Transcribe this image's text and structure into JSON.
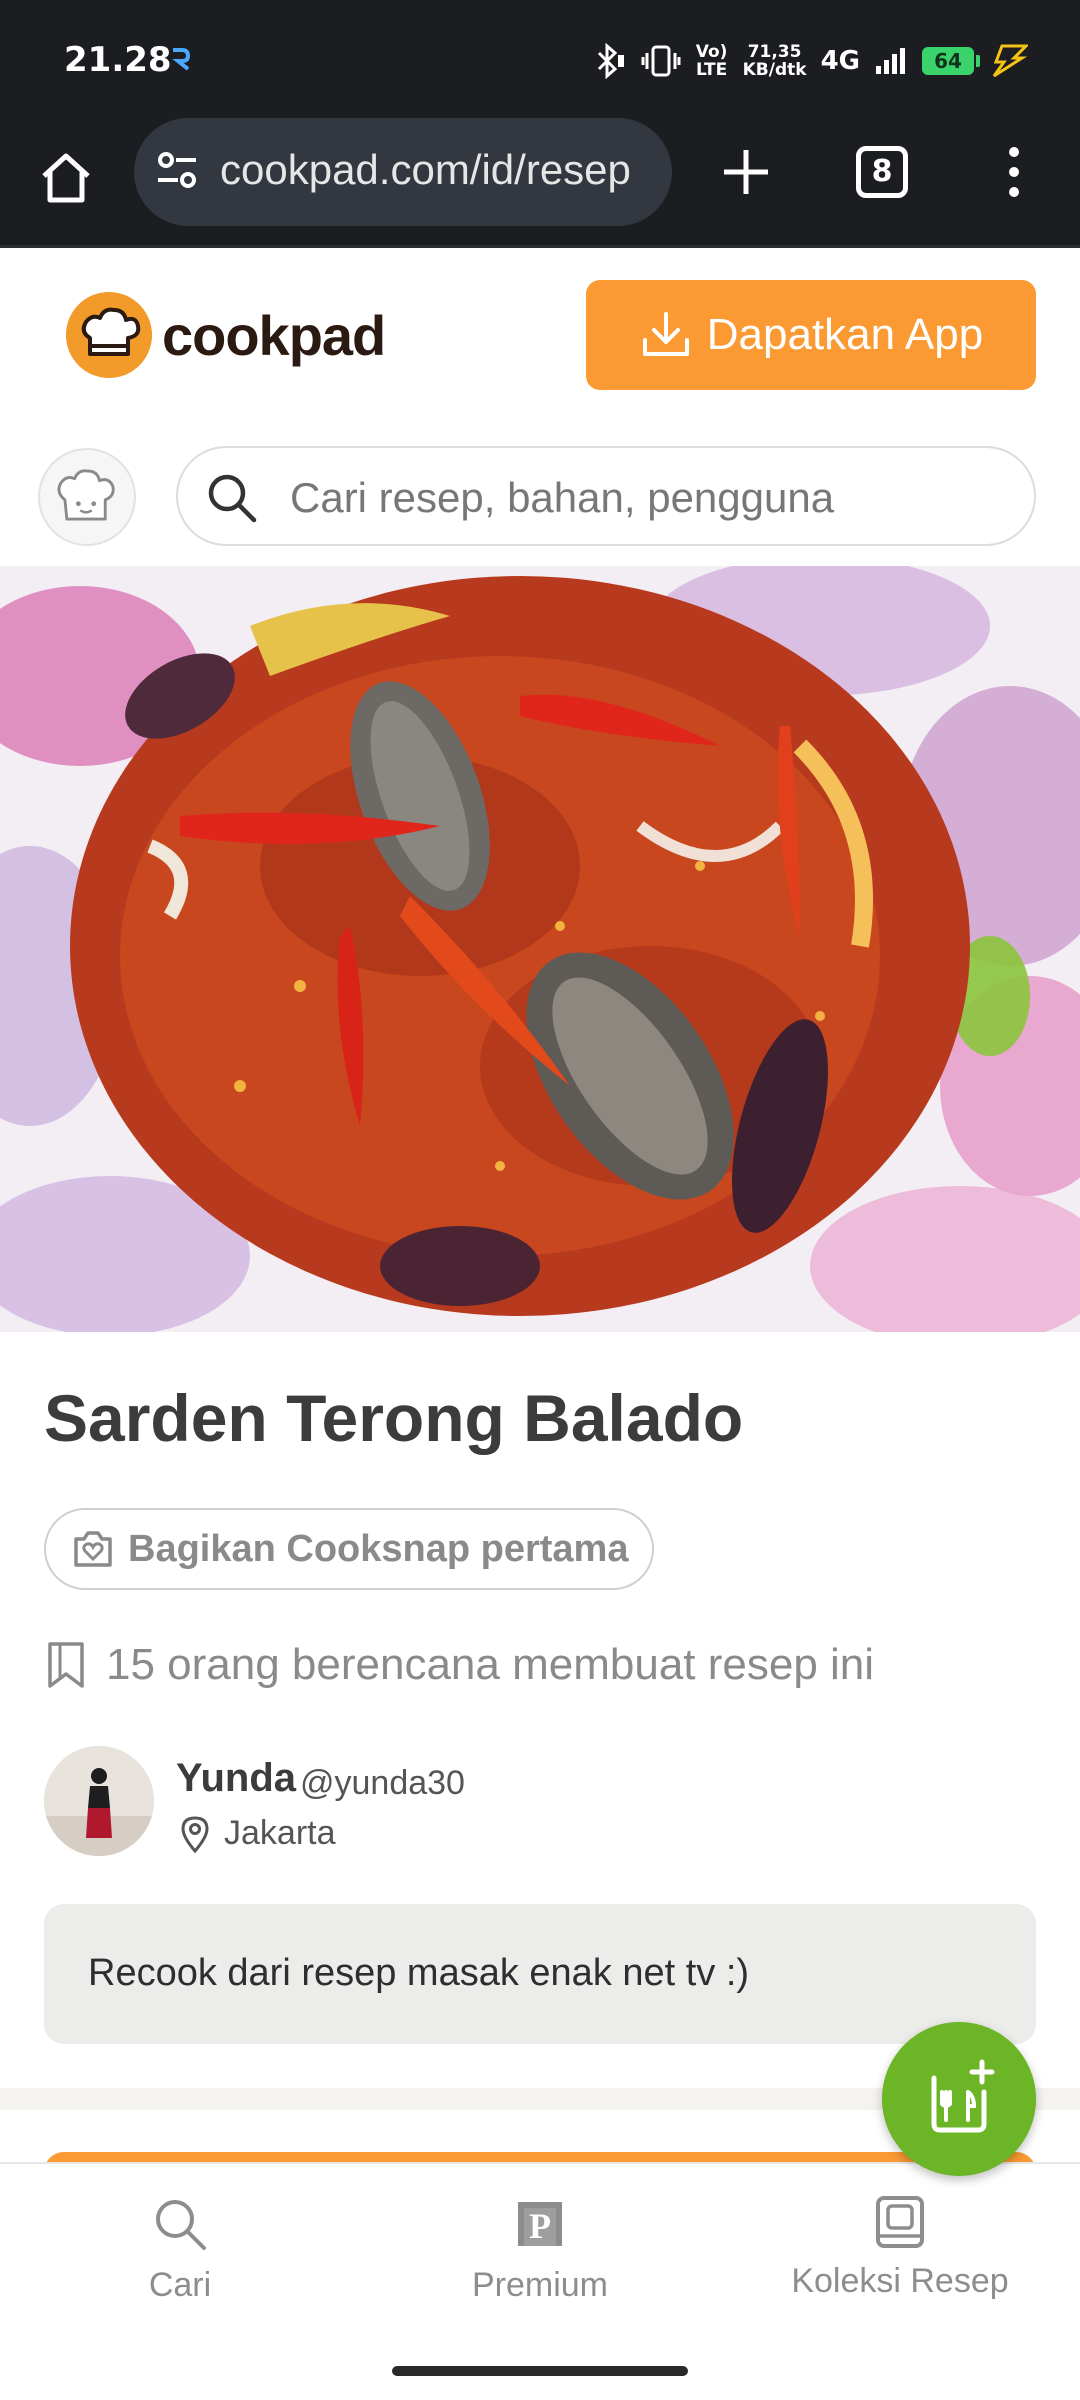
{
  "status_bar": {
    "time": "21.28",
    "net_speed_value": "71,35",
    "net_speed_unit": "KB/dtk",
    "volte_label": "Vo) LTE",
    "network": "4G",
    "battery": "64"
  },
  "browser": {
    "url": "cookpad.com/id/resep",
    "tab_count": "8"
  },
  "site": {
    "logo_text": "cookpad",
    "get_app_label": "Dapatkan App",
    "search_placeholder": "Cari resep, bahan, pengguna",
    "brand_color": "#fb9a33"
  },
  "recipe": {
    "title": "Sarden Terong Balado",
    "cooksnap_label": "Bagikan Cooksnap pertama",
    "plan_text": "15 orang berencana membuat resep ini",
    "author_name": "Yunda",
    "author_handle": "@yunda30",
    "author_location": "Jakarta",
    "note": "Recook dari resep masak enak net tv :)"
  },
  "bottom_nav": {
    "items": [
      {
        "label": "Cari",
        "icon": "search-icon"
      },
      {
        "label": "Premium",
        "icon": "premium-icon"
      },
      {
        "label": "Koleksi Resep",
        "icon": "recipe-collection-icon"
      }
    ]
  },
  "fab": {
    "icon": "add-recipe-icon",
    "color": "#6bb526"
  }
}
